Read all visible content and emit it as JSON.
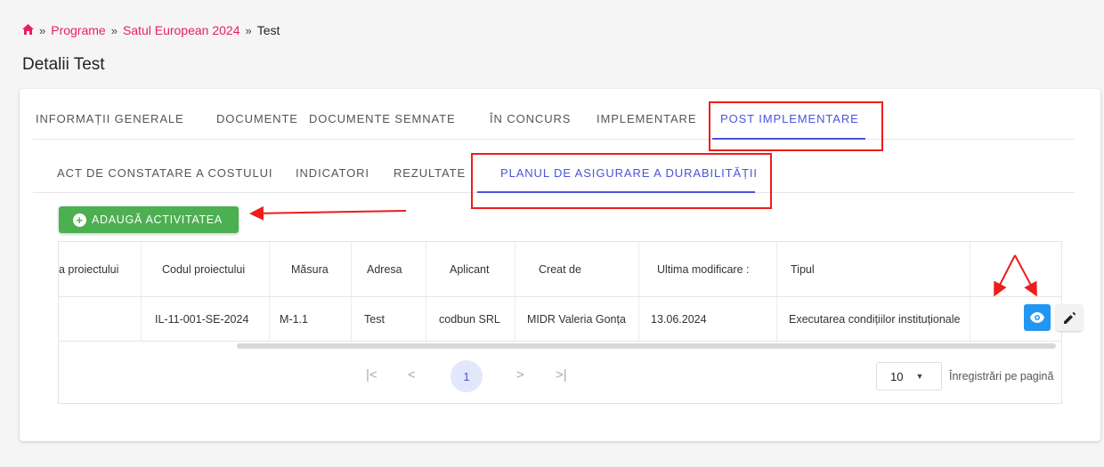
{
  "breadcrumb": {
    "items": [
      "Programe",
      "Satul European 2024"
    ],
    "separator": "»",
    "current": "Test"
  },
  "page_title": "Detalii Test",
  "tabs_main": [
    {
      "label": "INFORMAȚII GENERALE",
      "active": false
    },
    {
      "label": "DOCUMENTE",
      "active": false
    },
    {
      "label": "DOCUMENTE SEMNATE",
      "active": false
    },
    {
      "label": "ÎN CONCURS",
      "active": false
    },
    {
      "label": "IMPLEMENTARE",
      "active": false
    },
    {
      "label": "POST IMPLEMENTARE",
      "active": true
    }
  ],
  "tabs_sub": [
    {
      "label": "ACT DE CONSTATARE A COSTULUI",
      "active": false
    },
    {
      "label": "INDICATORI",
      "active": false
    },
    {
      "label": "REZULTATE",
      "active": false
    },
    {
      "label": "PLANUL DE ASIGURARE A DURABILITĂȚII",
      "active": true
    }
  ],
  "add_button_label": "ADAUGĂ ACTIVITATEA",
  "table": {
    "headers": [
      "a proiectului",
      "Codul proiectului",
      "Măsura",
      "Adresa",
      "Aplicant",
      "Creat de",
      "Ultima modificare :",
      "Tipul",
      ""
    ],
    "rows": [
      [
        "",
        "IL-11-001-SE-2024",
        "M-1.1",
        "Test",
        "codbun SRL",
        "MIDR Valeria Gonța",
        "13.06.2024",
        "Executarea condițiilor instituționale",
        ""
      ]
    ]
  },
  "pagination": {
    "first": "|<",
    "prev": "<",
    "current_page": "1",
    "next": ">",
    "last": ">|",
    "per_page": "10",
    "per_page_label": "Înregistrări pe pagină"
  },
  "colors": {
    "accent": "#4a55d9",
    "link": "#e91e63",
    "add_button": "#4caf50",
    "view_button": "#2196f3",
    "annotation": "#ee1c1c"
  },
  "icons": [
    "home-icon",
    "plus-circle-icon",
    "eye-icon",
    "pencil-icon",
    "chevron-down-icon"
  ]
}
